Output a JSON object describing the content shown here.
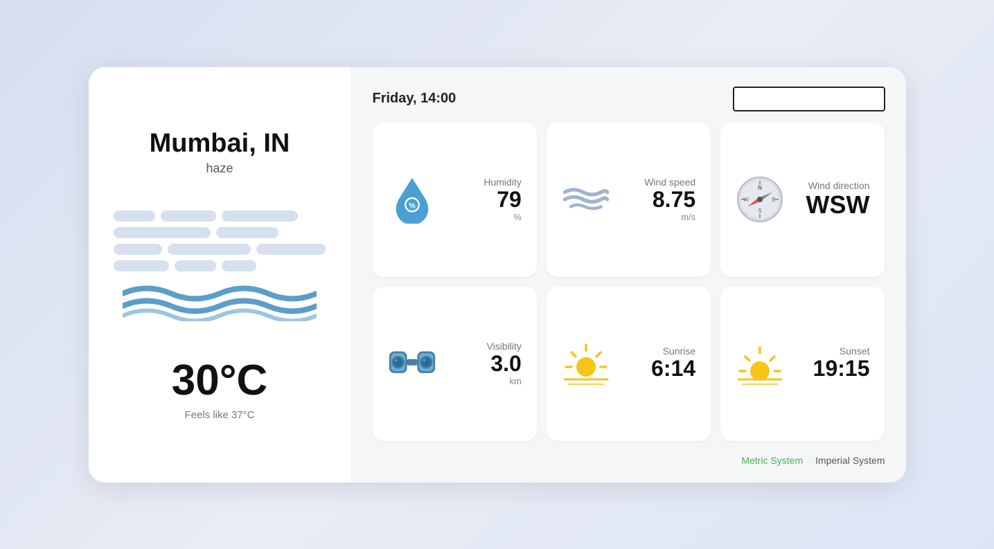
{
  "left": {
    "city": "Mumbai, IN",
    "condition": "haze",
    "temperature": "30°C",
    "feels_like": "Feels like 37°C"
  },
  "right": {
    "datetime": "Friday, 14:00",
    "search_placeholder": "",
    "tiles": [
      {
        "id": "humidity",
        "label": "Humidity",
        "value": "79",
        "unit": "%",
        "icon": "drop-icon"
      },
      {
        "id": "wind-speed",
        "label": "Wind speed",
        "value": "8.75",
        "unit": "m/s",
        "icon": "wind-icon"
      },
      {
        "id": "wind-direction",
        "label": "Wind direction",
        "value": "WSW",
        "unit": "",
        "icon": "compass-icon"
      },
      {
        "id": "visibility",
        "label": "Visibility",
        "value": "3.0",
        "unit": "km",
        "icon": "binoculars-icon"
      },
      {
        "id": "sunrise",
        "label": "Sunrise",
        "value": "6:14",
        "unit": "",
        "icon": "sunrise-icon"
      },
      {
        "id": "sunset",
        "label": "Sunset",
        "value": "19:15",
        "unit": "",
        "icon": "sunset-icon"
      }
    ],
    "units": {
      "metric": "Metric System",
      "imperial": "Imperial System",
      "active": "metric"
    }
  }
}
